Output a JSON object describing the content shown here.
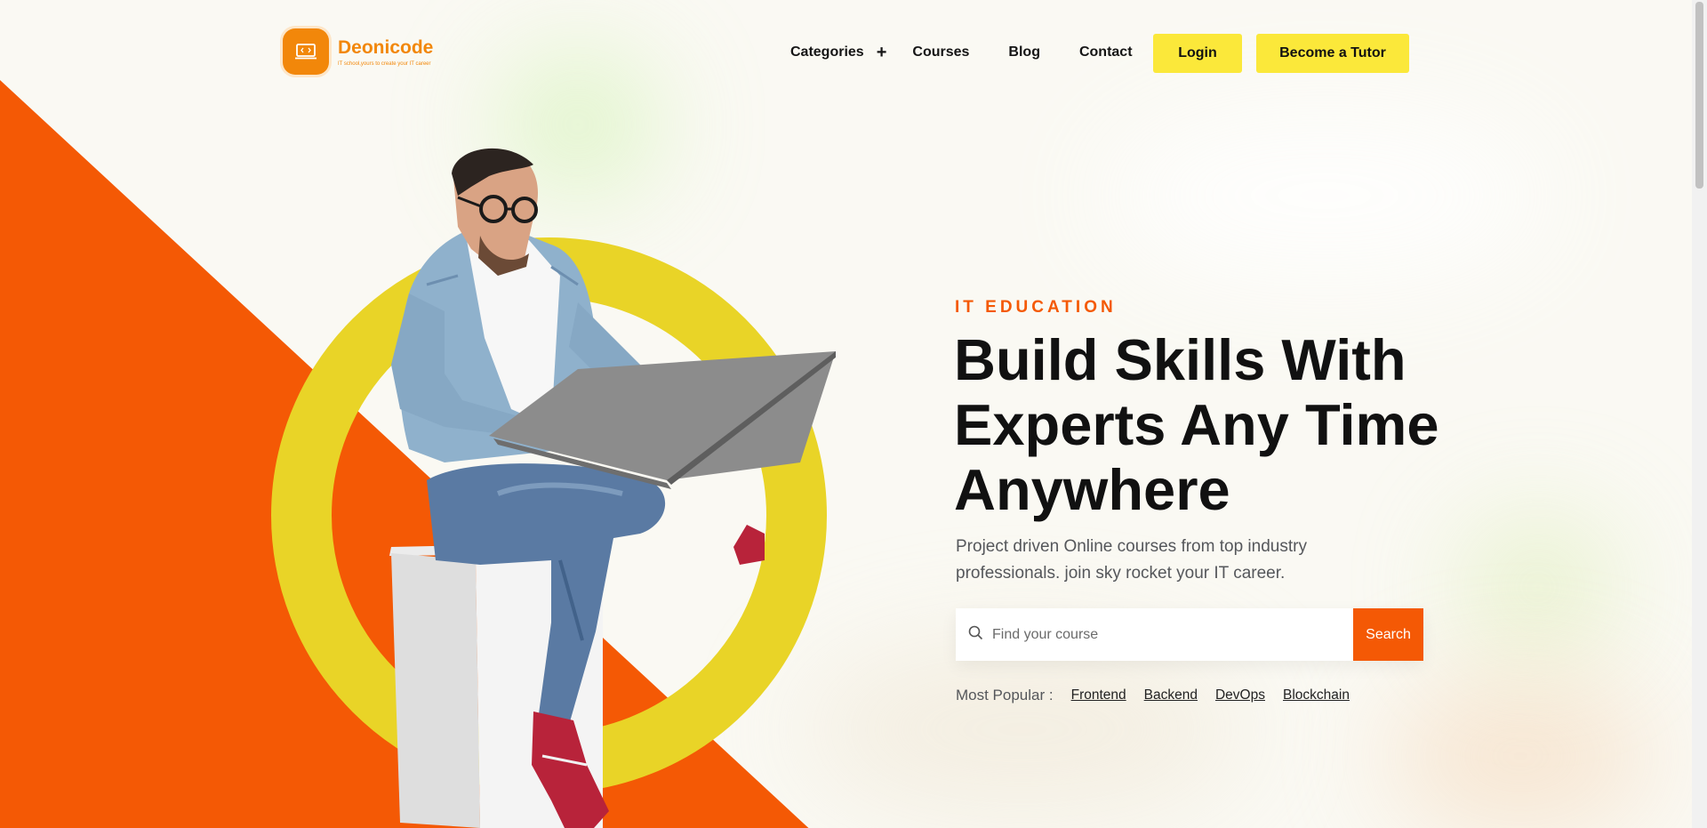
{
  "brand": {
    "name": "Deonicode",
    "tagline": "IT school,yours to create your IT career",
    "logo_icon": "laptop-code-icon",
    "accent": "#f2870a"
  },
  "nav": {
    "items": [
      {
        "label": "Categories",
        "has_expander": true
      },
      {
        "label": "Courses"
      },
      {
        "label": "Blog"
      },
      {
        "label": "Contact"
      }
    ]
  },
  "header_buttons": {
    "login": "Login",
    "become_tutor": "Become a Tutor"
  },
  "hero": {
    "eyebrow": "IT EDUCATION",
    "headline_line1": "Build Skills With",
    "headline_line2": "Experts Any Time",
    "headline_line3": "Anywhere",
    "subtext": "Project driven Online courses from top industry professionals. join sky rocket your IT career."
  },
  "search": {
    "placeholder": "Find your course",
    "value": "",
    "button_label": "Search",
    "icon": "search-icon"
  },
  "popular": {
    "label": "Most Popular :",
    "tags": [
      "Frontend",
      "Backend",
      "DevOps",
      "Blockchain"
    ]
  },
  "colors": {
    "orange": "#f45905",
    "yellow_ring": "#e9d427",
    "button_yellow": "#fbe83a",
    "text_dark": "#111111"
  }
}
